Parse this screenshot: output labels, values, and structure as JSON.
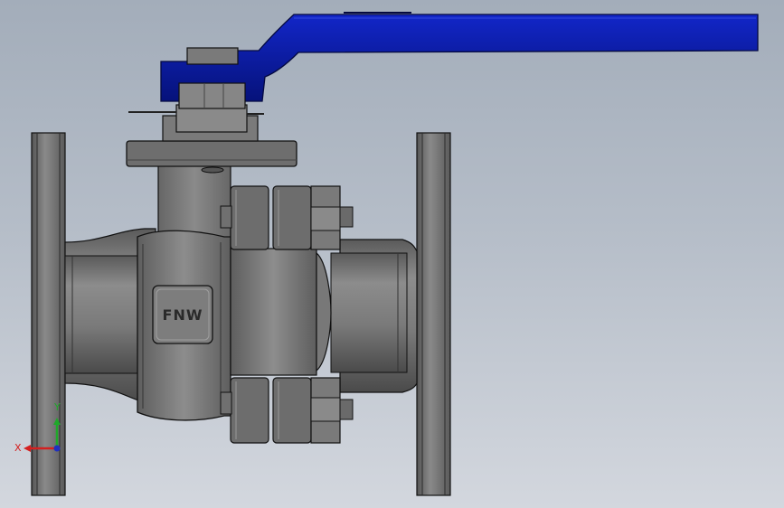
{
  "part": {
    "emboss_text": "FNW"
  },
  "triad": {
    "x_label": "X",
    "y_label": "Y",
    "x_color": "#d42020",
    "y_color": "#1fa82a",
    "z_color": "#2030c0"
  },
  "colors": {
    "handle": "#0a1aa8",
    "handle_dark": "#061070",
    "metal_light": "#9a9a9a",
    "metal_mid": "#6e6e6e",
    "metal_dark": "#3a3a3a",
    "edge": "#111111"
  }
}
